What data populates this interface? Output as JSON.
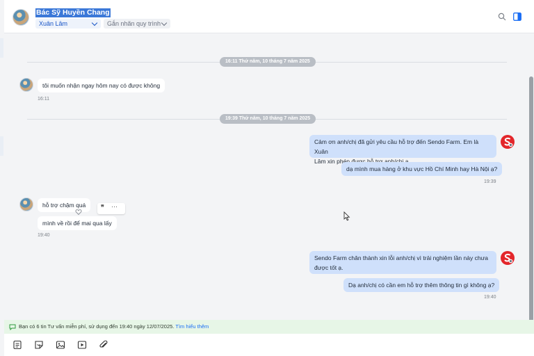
{
  "header": {
    "title": "Bác Sỹ Huyền Chang",
    "agent_select": "Xuân Lâm",
    "tag_select": "Gắn nhãn quy trình"
  },
  "chat": {
    "separators": [
      "16:11 Thứ năm, 10 tháng 7 năm 2025",
      "19:39 Thứ năm, 10 tháng 7 năm 2025"
    ],
    "msg1": {
      "text": "tôi muốn nhận ngay hôm nay có được không",
      "time": "16:11"
    },
    "out1": {
      "line1": "Cảm ơn anh/chị đã gửi yêu cầu hỗ trợ đến Sendo Farm. Em là Xuân",
      "line2": "Lâm xin phép được hỗ trợ anh/chị ạ.",
      "reply": "dạ mình mua hàng ở khu vực Hồ Chí Minh hay Hà Nội ạ?",
      "time": "19:39"
    },
    "msg2": {
      "text1": "hỗ trợ chậm quá",
      "text2": "mình về rồi để mai qua lấy",
      "time": "19:40"
    },
    "out2": {
      "line1": "Sendo Farm chân thành xin lỗi anh/chị vì trải nghiệm lần này chưa",
      "line2": "được tốt ạ.",
      "reply": "Dạ anh/chị có cần em hỗ trợ thêm thông tin gì không ạ?",
      "time": "19:40"
    }
  },
  "banner": {
    "text": "Bạn có 6 tin Tư vấn miễn phí, sử dụng đến 19:40 ngày 12/07/2025.",
    "link": "Tìm hiểu thêm"
  },
  "colors": {
    "accent": "#1a6ef5",
    "outgoing_bubble": "#cfe0fb",
    "sendo_red": "#e3262b",
    "banner_bg": "#e7f6e7"
  }
}
